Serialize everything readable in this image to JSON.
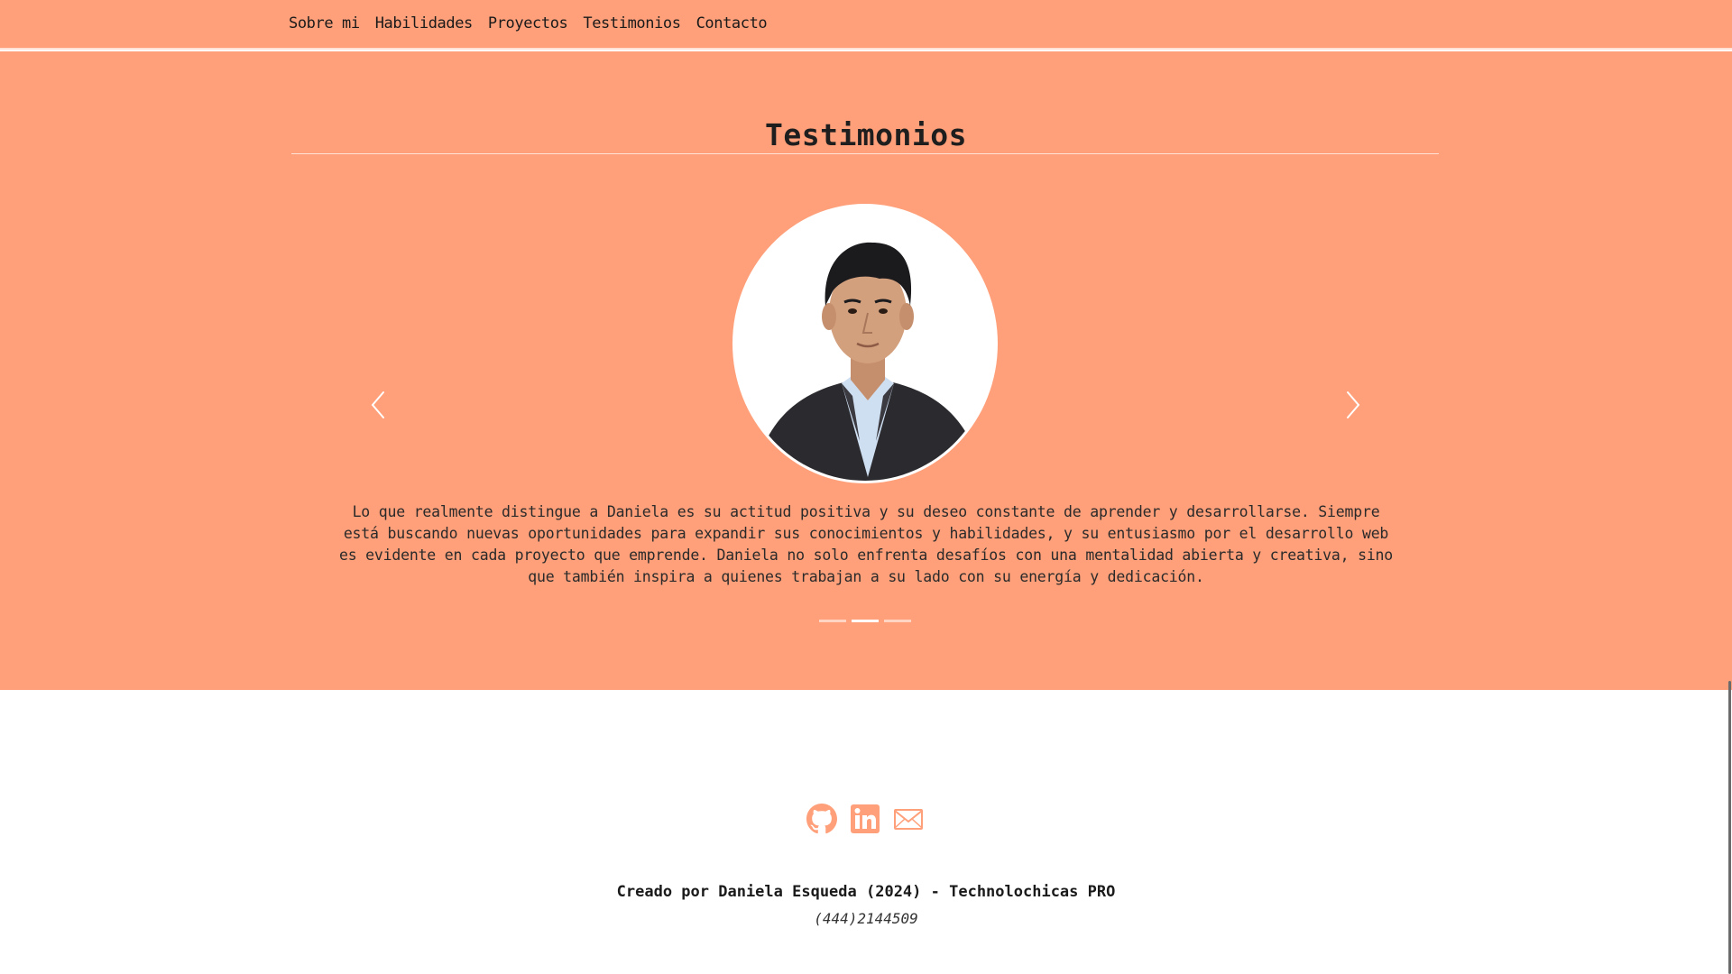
{
  "nav": {
    "items": [
      {
        "label": "Sobre mi"
      },
      {
        "label": "Habilidades"
      },
      {
        "label": "Proyectos"
      },
      {
        "label": "Testimonios"
      },
      {
        "label": "Contacto"
      }
    ]
  },
  "testimonials": {
    "title": "Testimonios",
    "quote": "Lo que realmente distingue a Daniela es su actitud positiva y su deseo constante de aprender y desarrollarse. Siempre está buscando nuevas oportunidades para expandir sus conocimientos y habilidades, y su entusiasmo por el desarrollo web es evidente en cada proyecto que emprende. Daniela no solo enfrenta desafíos con una mentalidad abierta y creativa, sino que también inspira a quienes trabajan a su lado con su energía y dedicación.",
    "slide_count": 3,
    "active_slide": 2,
    "prev_icon": "chevron-left-icon",
    "next_icon": "chevron-right-icon"
  },
  "footer": {
    "social": [
      {
        "icon": "github-icon"
      },
      {
        "icon": "linkedin-icon"
      },
      {
        "icon": "mail-icon"
      }
    ],
    "credits": "Creado por Daniela Esqueda (2024) - Technolochicas PRO",
    "phone": "(444)2144509"
  },
  "colors": {
    "accent": "#ffa07a",
    "text": "#1f1f1f",
    "footer_bg": "#ffffff"
  }
}
